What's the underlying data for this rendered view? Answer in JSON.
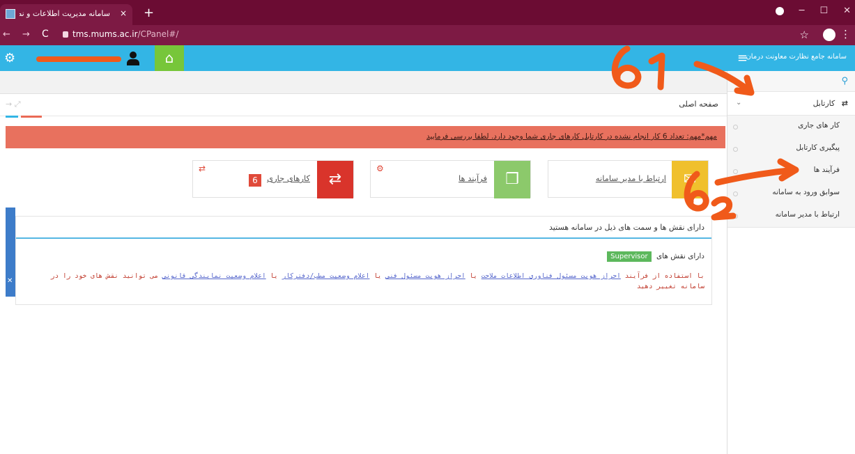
{
  "browser": {
    "tab_title": "سامانه مدیریت اطلاعات و نظارت د",
    "tab_close": "×",
    "new_tab": "+",
    "url_domain": "tms.mums.ac.ir",
    "url_path": "/CPanel#/",
    "back": "←",
    "forward": "→",
    "reload": "C",
    "star": "☆",
    "kebab": "⋮",
    "minimize": "─",
    "maximize": "☐",
    "close": "✕"
  },
  "header": {
    "app_title": "سامانه جامع نظارت معاونت درمان",
    "hamburger": "≡",
    "gear": "⚙",
    "home": "⌂"
  },
  "sidebar": {
    "search_icon": "⚲",
    "kartabl_icon": "⇄",
    "kartabl_label": "کارتابل",
    "chevron": "⌄",
    "items": [
      {
        "label": "کار های جاری"
      },
      {
        "label": "پیگیری کارتابل"
      },
      {
        "label": "فرآیند ها"
      },
      {
        "label": "سوابق ورود به سامانه"
      },
      {
        "label": "ارتباط با مدیر سامانه"
      }
    ]
  },
  "page": {
    "title": "صفحه اصلی",
    "toolbar_icons": "→  ⤢",
    "alert": "مهم*مهم: تعداد 6 کار انجام نشده در کارتابل کارهای جاری شما وجود دارد. لطفا بررسی فرمایید",
    "cards": {
      "current_tasks": {
        "label": "کارهای جاری",
        "count": "6",
        "icon": "⇄",
        "corner": "⇄"
      },
      "processes": {
        "label": "فرآیند ها",
        "icon": "❒",
        "corner": "⚙"
      },
      "contact_admin": {
        "label": "ارتباط با مدیر سامانه",
        "icon": "✉"
      }
    },
    "roles": {
      "heading": "دارای نقش ها و سمت های ذیل در سامانه هستید",
      "roles_label": "دارای نقش های",
      "role_badge": "Supervisor",
      "desc_prefix": "با استفاده از فرآیند",
      "desc_link1": "احراز هویت مسئول فناوری اطلاعات ملاحت",
      "desc_or1": "یا",
      "desc_link2": "احراز هویت مسئول فنی",
      "desc_or2": "یا",
      "desc_link3": "اعلام وضعیت مطب/دفترکار",
      "desc_or3": "یا",
      "desc_link4": "اعلام وضعیت نمایندگی قانونی",
      "desc_suffix": "می توانید نقش های خود را در سامانه تغییر دهید"
    },
    "left_tab_x": "✕"
  },
  "colors": {
    "tabbar": "#6b0c33",
    "header": "#33b5e5",
    "home": "#77c63a",
    "alert": "#e8715e",
    "tasks_icon": "#d9342b",
    "process_icon": "#8cc96b",
    "contact_icon": "#f0c02d",
    "annotation": "#f05a1a"
  }
}
